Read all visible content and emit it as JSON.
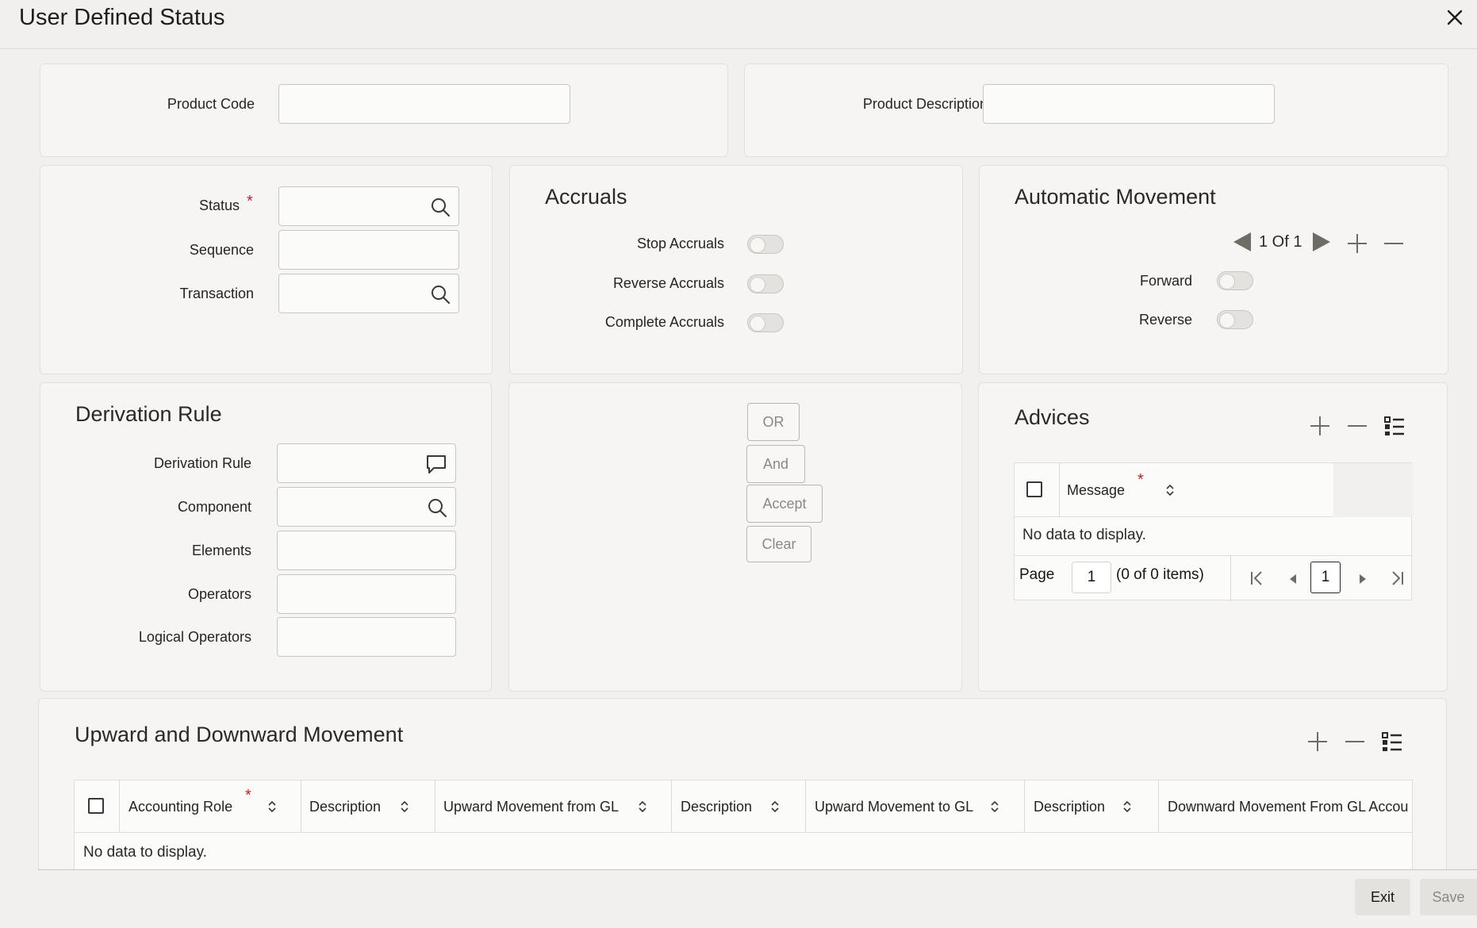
{
  "window": {
    "title": "User Defined Status"
  },
  "product": {
    "code_label": "Product Code",
    "code_value": "",
    "description_label": "Product Description",
    "description_value": ""
  },
  "status_panel": {
    "status_label": "Status",
    "sequence_label": "Sequence",
    "transaction_label": "Transaction",
    "required_mark": "*"
  },
  "accruals": {
    "heading": "Accruals",
    "stop_label": "Stop Accruals",
    "reverse_label": "Reverse Accruals",
    "complete_label": "Complete Accruals"
  },
  "automatic_movement": {
    "heading": "Automatic Movement",
    "pager": "1 Of 1",
    "forward_label": "Forward",
    "reverse_label": "Reverse"
  },
  "derivation": {
    "heading": "Derivation Rule",
    "rule_label": "Derivation Rule",
    "component_label": "Component",
    "elements_label": "Elements",
    "operators_label": "Operators",
    "logical_label": "Logical Operators"
  },
  "rule_buttons": {
    "or": "OR",
    "and": "And",
    "accept": "Accept",
    "clear": "Clear"
  },
  "advices": {
    "heading": "Advices",
    "column_message": "Message",
    "required_mark": "*",
    "no_data": "No data to display.",
    "page_label": "Page",
    "page_value": "1",
    "items_text": "(0 of 0 items)",
    "current_page": "1"
  },
  "movement": {
    "heading": "Upward and Downward Movement",
    "required_mark": "*",
    "columns": [
      "Accounting Role",
      "Description",
      "Upward Movement from GL",
      "Description",
      "Upward Movement to GL",
      "Description",
      "Downward Movement From GL Accou"
    ],
    "no_data": "No data to display."
  },
  "footer": {
    "exit": "Exit",
    "save": "Save"
  },
  "colors": {
    "accent": "#161513",
    "required": "#c0202a",
    "disabled_text": "#8c8883"
  }
}
